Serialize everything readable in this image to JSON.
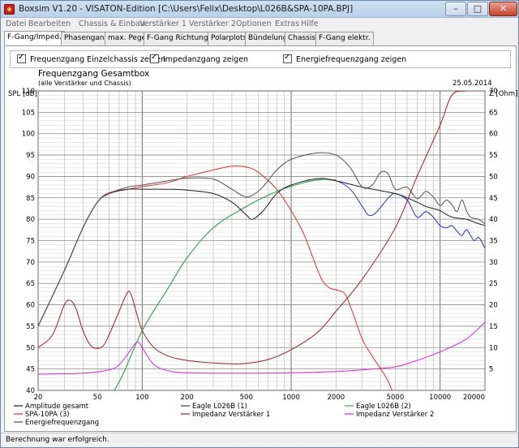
{
  "window": {
    "title": "Boxsim V1.20 - VISATON-Edition [C:\\Users\\Felix\\Desktop\\L026B&SPA-10PA.BPJ]",
    "min_label": "–",
    "max_label": "□",
    "close_label": "✕"
  },
  "menu": [
    "Datei",
    "Bearbeiten",
    "Chassis & Einbau",
    "Verstärker 1",
    "Verstärker 2",
    "Optionen",
    "Extras",
    "Hilfe"
  ],
  "tabs": [
    {
      "label": "F-Gang/Impeд.",
      "active": true
    },
    {
      "label": "Phasengang",
      "active": false
    },
    {
      "label": "max. Pegel",
      "active": false
    },
    {
      "label": "F-Gang Richtungen",
      "active": false
    },
    {
      "label": "Polarplots",
      "active": false
    },
    {
      "label": "Bündelung",
      "active": false
    },
    {
      "label": "Chassis",
      "active": false
    },
    {
      "label": "F-Gang elektr.",
      "active": false
    }
  ],
  "checkboxes": [
    {
      "label": "Frequenzgang Einzelchassis zeigen",
      "checked": true
    },
    {
      "label": "Impedanzgang zeigen",
      "checked": true
    },
    {
      "label": "Energiefrequenzgang zeigen",
      "checked": true
    }
  ],
  "status": {
    "text": "Berechnung war erfolgreich."
  },
  "chart_data": {
    "type": "line",
    "title": "Frequenzgang Gesamtbox",
    "subtitle": "(alle Verstärker und Chassis)",
    "date": "25.05.2014",
    "ylabel": "SPL [dB]",
    "y2label": "Z [Ohm]",
    "xscale": "log",
    "xlim": [
      20,
      20000
    ],
    "ylim": [
      40,
      110
    ],
    "y2lim": [
      0,
      70
    ],
    "x_ticks": [
      "20",
      "50",
      "100",
      "200",
      "500",
      "1000",
      "2000",
      "5000",
      "10000",
      "20000"
    ],
    "y_ticks": [
      "40",
      "45",
      "50",
      "55",
      "60",
      "65",
      "70",
      "75",
      "80",
      "85",
      "90",
      "95",
      "100",
      "105",
      "110"
    ],
    "y2_ticks": [
      "5",
      "10",
      "15",
      "20",
      "25",
      "30",
      "35",
      "40",
      "45",
      "50",
      "55",
      "60",
      "65",
      "70"
    ],
    "grid": true,
    "legend_position": "bottom",
    "series": [
      {
        "name": "Amplitude gesamt",
        "axis": "left",
        "color": "#202020",
        "points": [
          [
            20,
            55
          ],
          [
            30,
            68
          ],
          [
            40,
            78
          ],
          [
            50,
            84
          ],
          [
            60,
            86
          ],
          [
            80,
            87
          ],
          [
            100,
            87
          ],
          [
            150,
            87
          ],
          [
            200,
            86.8
          ],
          [
            300,
            86
          ],
          [
            400,
            84
          ],
          [
            500,
            81
          ],
          [
            550,
            80
          ],
          [
            650,
            82
          ],
          [
            800,
            86
          ],
          [
            1000,
            88
          ],
          [
            1500,
            89.5
          ],
          [
            2000,
            89
          ],
          [
            3000,
            87.5
          ],
          [
            5000,
            86
          ],
          [
            6000,
            85
          ],
          [
            7000,
            84
          ],
          [
            8000,
            83
          ],
          [
            9000,
            82.5
          ],
          [
            10000,
            82
          ],
          [
            12000,
            80.5
          ],
          [
            15000,
            80
          ],
          [
            18000,
            79
          ],
          [
            20000,
            78.5
          ]
        ]
      },
      {
        "name": "Eagle L026B (1)",
        "axis": "left",
        "color": "#2030d0",
        "points": [
          [
            20,
            31
          ],
          [
            50,
            36
          ],
          [
            70,
            42
          ],
          [
            100,
            54
          ],
          [
            150,
            64
          ],
          [
            200,
            71
          ],
          [
            300,
            78
          ],
          [
            500,
            83
          ],
          [
            800,
            86.5
          ],
          [
            1200,
            88.5
          ],
          [
            1600,
            89.3
          ],
          [
            2000,
            89
          ],
          [
            2500,
            87
          ],
          [
            3000,
            83
          ],
          [
            3300,
            81
          ],
          [
            3700,
            81.5
          ],
          [
            4500,
            85
          ],
          [
            5000,
            86
          ],
          [
            6000,
            84.5
          ],
          [
            7000,
            80.5
          ],
          [
            8000,
            81.8
          ],
          [
            9000,
            80.5
          ],
          [
            10000,
            78.5
          ],
          [
            11000,
            78
          ],
          [
            12000,
            78.5
          ],
          [
            13000,
            77.2
          ],
          [
            14000,
            76.2
          ],
          [
            15000,
            77.6
          ],
          [
            16000,
            76.2
          ],
          [
            17000,
            75
          ],
          [
            18000,
            75.8
          ],
          [
            19000,
            74.8
          ],
          [
            20000,
            73.2
          ]
        ]
      },
      {
        "name": "Eagle L026B (2)",
        "axis": "left",
        "color": "#40b040",
        "points": [
          [
            20,
            31
          ],
          [
            50,
            36
          ],
          [
            70,
            42
          ],
          [
            100,
            54
          ],
          [
            150,
            64
          ],
          [
            200,
            71
          ],
          [
            300,
            78
          ],
          [
            500,
            83
          ],
          [
            800,
            86.5
          ],
          [
            1200,
            88.5
          ],
          [
            1600,
            89.3
          ],
          [
            2000,
            89.2
          ]
        ]
      },
      {
        "name": "SPA-10PA (3)",
        "axis": "left",
        "color": "#e03030",
        "points": [
          [
            20,
            55
          ],
          [
            30,
            68
          ],
          [
            40,
            78
          ],
          [
            50,
            84
          ],
          [
            60,
            86.2
          ],
          [
            80,
            87
          ],
          [
            100,
            87.6
          ],
          [
            150,
            88.6
          ],
          [
            200,
            90
          ],
          [
            300,
            91.5
          ],
          [
            400,
            92.4
          ],
          [
            500,
            92.2
          ],
          [
            600,
            91
          ],
          [
            800,
            87
          ],
          [
            1000,
            82
          ],
          [
            1200,
            77
          ],
          [
            1400,
            71
          ],
          [
            1600,
            66
          ],
          [
            1800,
            64
          ],
          [
            2000,
            63.5
          ],
          [
            2300,
            62.5
          ],
          [
            2600,
            58
          ],
          [
            3000,
            52
          ],
          [
            3500,
            48
          ],
          [
            4000,
            45
          ],
          [
            4500,
            42
          ],
          [
            5000,
            38
          ]
        ]
      },
      {
        "name": "Impedanz Verstärker 1",
        "axis": "right",
        "color": "#9a2020",
        "points": [
          [
            20,
            10
          ],
          [
            25,
            13
          ],
          [
            30,
            20
          ],
          [
            33,
            21
          ],
          [
            36,
            19
          ],
          [
            40,
            14
          ],
          [
            45,
            10.5
          ],
          [
            50,
            9.8
          ],
          [
            55,
            10.5
          ],
          [
            60,
            13
          ],
          [
            70,
            18.5
          ],
          [
            80,
            23
          ],
          [
            85,
            22
          ],
          [
            90,
            19
          ],
          [
            100,
            14
          ],
          [
            120,
            10
          ],
          [
            150,
            8
          ],
          [
            200,
            7
          ],
          [
            300,
            6.4
          ],
          [
            400,
            6.2
          ],
          [
            500,
            6.3
          ],
          [
            700,
            7.2
          ],
          [
            1000,
            9.5
          ],
          [
            1500,
            13.5
          ],
          [
            2000,
            18.5
          ],
          [
            3000,
            26
          ],
          [
            5000,
            38
          ],
          [
            7000,
            50
          ],
          [
            10000,
            62
          ],
          [
            12000,
            69
          ],
          [
            15000,
            70
          ],
          [
            20000,
            70
          ]
        ]
      },
      {
        "name": "Impedanz Verstärker 2",
        "axis": "right",
        "color": "#e020e0",
        "points": [
          [
            20,
            3.8
          ],
          [
            40,
            4
          ],
          [
            60,
            4.8
          ],
          [
            70,
            6
          ],
          [
            80,
            8.5
          ],
          [
            90,
            11
          ],
          [
            95,
            11.2
          ],
          [
            100,
            10
          ],
          [
            120,
            6
          ],
          [
            150,
            4.6
          ],
          [
            200,
            4.1
          ],
          [
            500,
            4
          ],
          [
            1000,
            4.1
          ],
          [
            2000,
            4.4
          ],
          [
            3000,
            4.8
          ],
          [
            5000,
            5.5
          ],
          [
            7000,
            7
          ],
          [
            10000,
            9
          ],
          [
            15000,
            12
          ],
          [
            20000,
            16
          ]
        ]
      },
      {
        "name": "Energiefrequenzgang",
        "axis": "left",
        "color": "#505050",
        "points": [
          [
            20,
            55
          ],
          [
            30,
            68
          ],
          [
            40,
            78
          ],
          [
            50,
            84
          ],
          [
            60,
            86
          ],
          [
            80,
            87.5
          ],
          [
            100,
            88
          ],
          [
            150,
            89
          ],
          [
            200,
            89.6
          ],
          [
            300,
            89.4
          ],
          [
            400,
            87
          ],
          [
            500,
            85.2
          ],
          [
            600,
            86.5
          ],
          [
            700,
            89
          ],
          [
            800,
            91.5
          ],
          [
            1000,
            94
          ],
          [
            1500,
            95.5
          ],
          [
            2000,
            95
          ],
          [
            2500,
            92
          ],
          [
            3000,
            87.5
          ],
          [
            3500,
            88
          ],
          [
            4000,
            91
          ],
          [
            4500,
            90.5
          ],
          [
            5000,
            87
          ],
          [
            6000,
            87.5
          ],
          [
            7000,
            84.8
          ],
          [
            8000,
            86.5
          ],
          [
            9000,
            85.2
          ],
          [
            10000,
            83.2
          ],
          [
            11000,
            84.5
          ],
          [
            12000,
            83.4
          ],
          [
            13000,
            81.8
          ],
          [
            14000,
            84.5
          ],
          [
            15000,
            82
          ],
          [
            16000,
            80.5
          ],
          [
            18000,
            80
          ],
          [
            20000,
            79
          ]
        ]
      }
    ]
  }
}
